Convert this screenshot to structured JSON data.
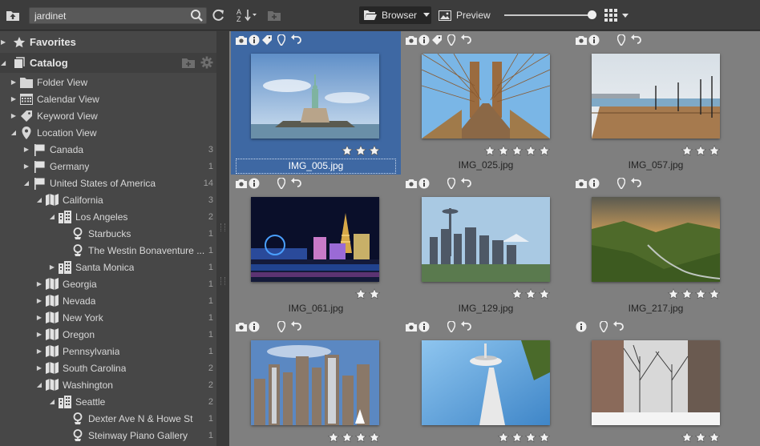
{
  "search": {
    "value": "jardinet"
  },
  "toolbar": {
    "browser_label": "Browser",
    "preview_label": "Preview"
  },
  "sidebar": {
    "favorites_label": "Favorites",
    "catalog_label": "Catalog",
    "items": [
      {
        "label": "Folder View",
        "count": ""
      },
      {
        "label": "Calendar View",
        "count": ""
      },
      {
        "label": "Keyword View",
        "count": ""
      },
      {
        "label": "Location View",
        "count": ""
      },
      {
        "label": "Canada",
        "count": "3"
      },
      {
        "label": "Germany",
        "count": "1"
      },
      {
        "label": "United States of America",
        "count": "14"
      },
      {
        "label": "California",
        "count": "3"
      },
      {
        "label": "Los Angeles",
        "count": "2"
      },
      {
        "label": "Starbucks",
        "count": "1"
      },
      {
        "label": "The Westin Bonaventure ...",
        "count": "1"
      },
      {
        "label": "Santa Monica",
        "count": "1"
      },
      {
        "label": "Georgia",
        "count": "1"
      },
      {
        "label": "Nevada",
        "count": "1"
      },
      {
        "label": "New York",
        "count": "1"
      },
      {
        "label": "Oregon",
        "count": "1"
      },
      {
        "label": "Pennsylvania",
        "count": "1"
      },
      {
        "label": "South Carolina",
        "count": "2"
      },
      {
        "label": "Washington",
        "count": "2"
      },
      {
        "label": "Seattle",
        "count": "2"
      },
      {
        "label": "Dexter Ave N & Howe St",
        "count": "1"
      },
      {
        "label": "Steinway Piano Gallery",
        "count": "1"
      }
    ]
  },
  "photos": [
    {
      "filename": "IMG_005.jpg",
      "rating": 3,
      "scene": "statue",
      "icons": [
        "camera",
        "info",
        "tag",
        "pin",
        "undo"
      ]
    },
    {
      "filename": "IMG_025.jpg",
      "rating": 5,
      "scene": "bridge",
      "icons": [
        "camera",
        "info",
        "tag",
        "pin",
        "undo"
      ]
    },
    {
      "filename": "IMG_057.jpg",
      "rating": 3,
      "scene": "pier",
      "icons": [
        "camera",
        "info",
        "pin",
        "undo"
      ]
    },
    {
      "filename": "IMG_061.jpg",
      "rating": 2,
      "scene": "vegas",
      "icons": [
        "camera",
        "info",
        "pin",
        "undo"
      ]
    },
    {
      "filename": "IMG_129.jpg",
      "rating": 3,
      "scene": "seattle",
      "icons": [
        "camera",
        "info",
        "pin",
        "undo"
      ]
    },
    {
      "filename": "IMG_217.jpg",
      "rating": 4,
      "scene": "gorge",
      "icons": [
        "camera",
        "info",
        "pin",
        "undo"
      ]
    },
    {
      "filename": "",
      "rating": 4,
      "scene": "skyline",
      "icons": [
        "camera",
        "info",
        "pin",
        "undo"
      ]
    },
    {
      "filename": "",
      "rating": 4,
      "scene": "needle",
      "icons": [
        "camera",
        "info",
        "pin",
        "undo"
      ]
    },
    {
      "filename": "",
      "rating": 3,
      "scene": "snow",
      "icons": [
        "info",
        "pin",
        "undo"
      ]
    }
  ],
  "colors": {
    "selection": "#3e68a3",
    "grid_bg": "#7f7f7f",
    "sidebar_bg": "#474747"
  }
}
